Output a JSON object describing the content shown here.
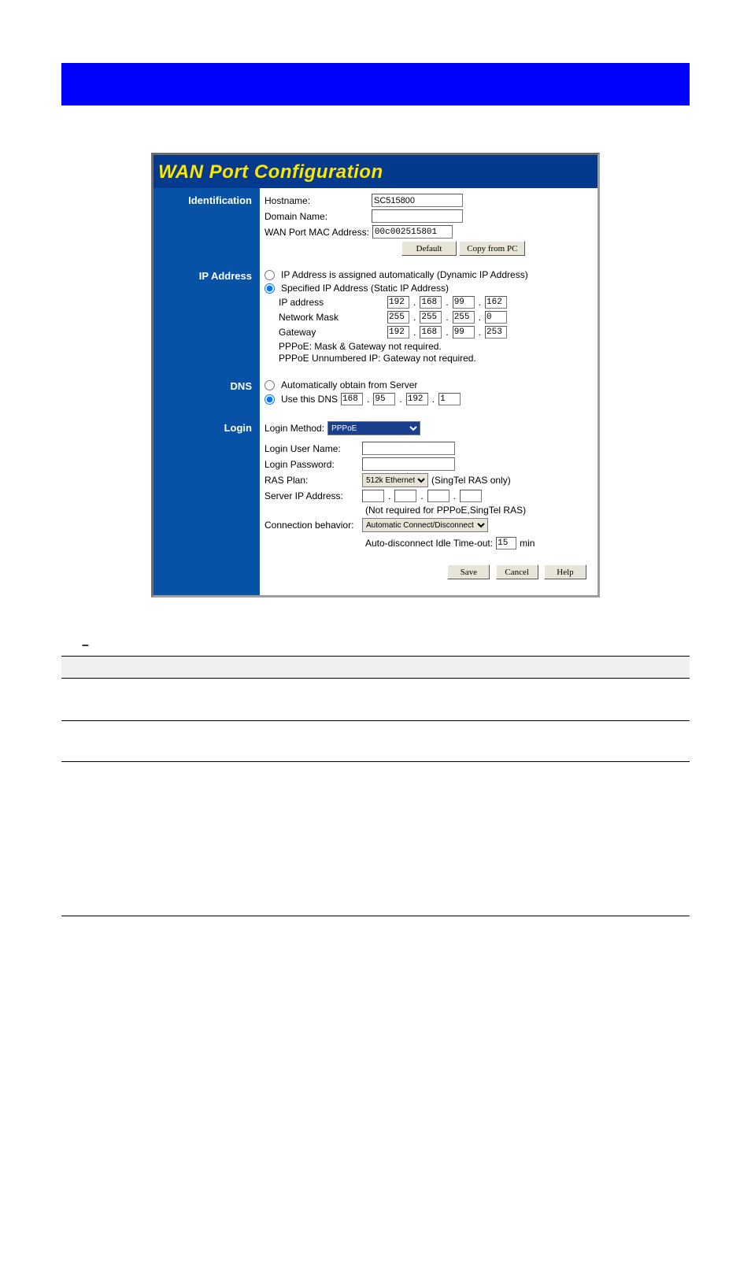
{
  "figure": {
    "title": "WAN Port Configuration",
    "sections": {
      "identification": {
        "label": "Identification",
        "hostname_label": "Hostname:",
        "hostname_value": "SC515800",
        "domain_label": "Domain Name:",
        "domain_value": "",
        "mac_label": "WAN Port MAC Address:",
        "mac_value": "00c002515801",
        "btn_default": "Default",
        "btn_copy": "Copy from PC"
      },
      "ip": {
        "label": "IP Address",
        "opt_dynamic": "IP Address is assigned automatically (Dynamic IP Address)",
        "opt_static": "Specified IP Address (Static IP Address)",
        "ip_label": "IP address",
        "ip_value": [
          "192",
          "168",
          "99",
          "162"
        ],
        "mask_label": "Network Mask",
        "mask_value": [
          "255",
          "255",
          "255",
          "0"
        ],
        "gw_label": "Gateway",
        "gw_value": [
          "192",
          "168",
          "99",
          "253"
        ],
        "note1": "PPPoE: Mask & Gateway not required.",
        "note2": "PPPoE Unnumbered IP: Gateway not required."
      },
      "dns": {
        "label": "DNS",
        "opt_auto": "Automatically obtain from Server",
        "opt_use": "Use this DNS",
        "dns_value": [
          "168",
          "95",
          "192",
          "1"
        ]
      },
      "login": {
        "label": "Login",
        "method_label": "Login Method:",
        "method_value": "PPPoE",
        "user_label": "Login User Name:",
        "user_value": "",
        "pass_label": "Login Password:",
        "pass_value": "",
        "ras_label": "RAS Plan:",
        "ras_value": "512k Ethernet",
        "ras_note": "(SingTel RAS only)",
        "server_label": "Server IP Address:",
        "server_value": [
          "",
          "",
          "",
          ""
        ],
        "server_note": "(Not required for PPPoE,SingTel RAS)",
        "conn_label": "Connection behavior:",
        "conn_value": "Automatic Connect/Disconnect",
        "idle_label_pre": "Auto-disconnect Idle Time-out:",
        "idle_value": "15",
        "idle_label_post": "min"
      }
    },
    "footer": {
      "save": "Save",
      "cancel": "Cancel",
      "help": "Help"
    }
  },
  "table": {
    "dash": "–"
  }
}
